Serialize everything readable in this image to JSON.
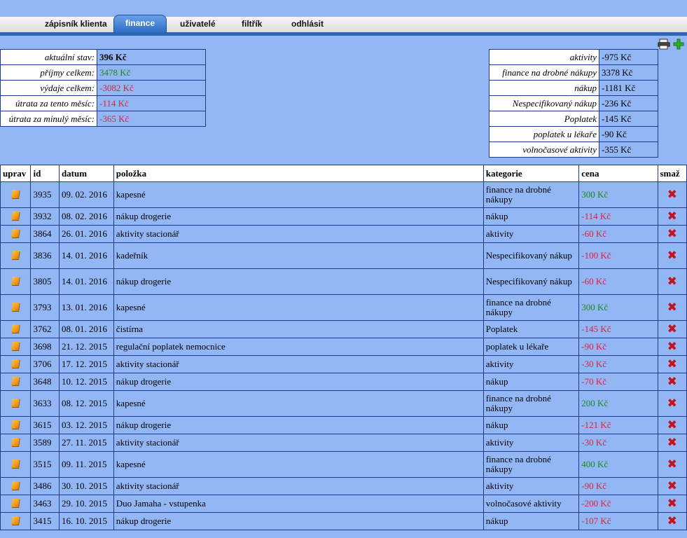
{
  "nav": [
    "zápisník klienta",
    "finance",
    "uživatelé",
    "filtřík",
    "odhlásit"
  ],
  "summary_left": [
    {
      "label": "aktuální stav:",
      "value": "396 Kč",
      "style": "bold"
    },
    {
      "label": "příjmy celkem:",
      "value": "3478 Kč",
      "style": "pos"
    },
    {
      "label": "výdaje celkem:",
      "value": "-3082 Kč",
      "style": "neg"
    },
    {
      "label": "útrata za tento měsíc:",
      "value": "-114 Kč",
      "style": "neg"
    },
    {
      "label": "útrata za minulý měsíc:",
      "value": "-365 Kč",
      "style": "neg"
    }
  ],
  "summary_right": [
    {
      "label": "aktivity",
      "value": "-975 Kč"
    },
    {
      "label": "finance na drobné nákupy",
      "value": "3378 Kč"
    },
    {
      "label": "nákup",
      "value": "-1181 Kč"
    },
    {
      "label": "Nespecifikovaný nákup",
      "value": "-236 Kč"
    },
    {
      "label": "Poplatek",
      "value": "-145 Kč"
    },
    {
      "label": "poplatek u lékaře",
      "value": "-90 Kč"
    },
    {
      "label": "volnočasové aktivity",
      "value": "-355 Kč"
    }
  ],
  "table": {
    "headers": [
      "uprav",
      "id",
      "datum",
      "položka",
      "kategorie",
      "cena",
      "smaž"
    ],
    "rows": [
      {
        "id": "3935",
        "date": "09. 02. 2016",
        "item": "kapesné",
        "cat": "finance na drobné nákupy",
        "price": "300 Kč",
        "pos": true,
        "tall": true
      },
      {
        "id": "3932",
        "date": "08. 02. 2016",
        "item": "nákup drogerie",
        "cat": "nákup",
        "price": "-114 Kč",
        "pos": false,
        "tall": false
      },
      {
        "id": "3864",
        "date": "26. 01. 2016",
        "item": "aktivity stacionář",
        "cat": "aktivity",
        "price": "-60 Kč",
        "pos": false,
        "tall": false
      },
      {
        "id": "3836",
        "date": "14. 01. 2016",
        "item": "kadeřník",
        "cat": "Nespecifikovaný nákup",
        "price": "-100 Kč",
        "pos": false,
        "tall": true
      },
      {
        "id": "3805",
        "date": "14. 01. 2016",
        "item": "nákup drogerie",
        "cat": "Nespecifikovaný nákup",
        "price": "-60 Kč",
        "pos": false,
        "tall": true
      },
      {
        "id": "3793",
        "date": "13. 01. 2016",
        "item": "kapesné",
        "cat": "finance na drobné nákupy",
        "price": "300 Kč",
        "pos": true,
        "tall": true
      },
      {
        "id": "3762",
        "date": "08. 01. 2016",
        "item": "čistírna",
        "cat": "Poplatek",
        "price": "-145 Kč",
        "pos": false,
        "tall": false
      },
      {
        "id": "3698",
        "date": "21. 12. 2015",
        "item": "regulační poplatek nemocnice",
        "cat": "poplatek u lékaře",
        "price": "-90 Kč",
        "pos": false,
        "tall": false
      },
      {
        "id": "3706",
        "date": "17. 12. 2015",
        "item": "aktivity stacionář",
        "cat": "aktivity",
        "price": "-30 Kč",
        "pos": false,
        "tall": false
      },
      {
        "id": "3648",
        "date": "10. 12. 2015",
        "item": "nákup drogerie",
        "cat": "nákup",
        "price": "-70 Kč",
        "pos": false,
        "tall": false
      },
      {
        "id": "3633",
        "date": "08. 12. 2015",
        "item": "kapesné",
        "cat": "finance na drobné nákupy",
        "price": "200 Kč",
        "pos": true,
        "tall": true
      },
      {
        "id": "3615",
        "date": "03. 12. 2015",
        "item": "nákup drogerie",
        "cat": "nákup",
        "price": "-121 Kč",
        "pos": false,
        "tall": false
      },
      {
        "id": "3589",
        "date": "27. 11. 2015",
        "item": "aktivity stacionář",
        "cat": "aktivity",
        "price": "-30 Kč",
        "pos": false,
        "tall": false
      },
      {
        "id": "3515",
        "date": "09. 11. 2015",
        "item": "kapesné",
        "cat": "finance na drobné nákupy",
        "price": "400 Kč",
        "pos": true,
        "tall": true
      },
      {
        "id": "3486",
        "date": "30. 10. 2015",
        "item": "aktivity stacionář",
        "cat": "aktivity",
        "price": "-90 Kč",
        "pos": false,
        "tall": false
      },
      {
        "id": "3463",
        "date": "29. 10. 2015",
        "item": "Duo Jamaha - vstupenka",
        "cat": "volnočasové aktivity",
        "price": "-200 Kč",
        "pos": false,
        "tall": false
      },
      {
        "id": "3415",
        "date": "16. 10. 2015",
        "item": "nákup drogerie",
        "cat": "nákup",
        "price": "-107 Kč",
        "pos": false,
        "tall": false
      }
    ]
  },
  "icons": {
    "print": "printer-icon",
    "add": "add-plus-icon",
    "edit": "edit-pencil-icon",
    "delete": "delete-x-icon"
  },
  "colors": {
    "positive": "#1a8a1a",
    "negative": "#e0203a",
    "tab_active": "#2f6fc6",
    "background": "#93b6f5"
  }
}
